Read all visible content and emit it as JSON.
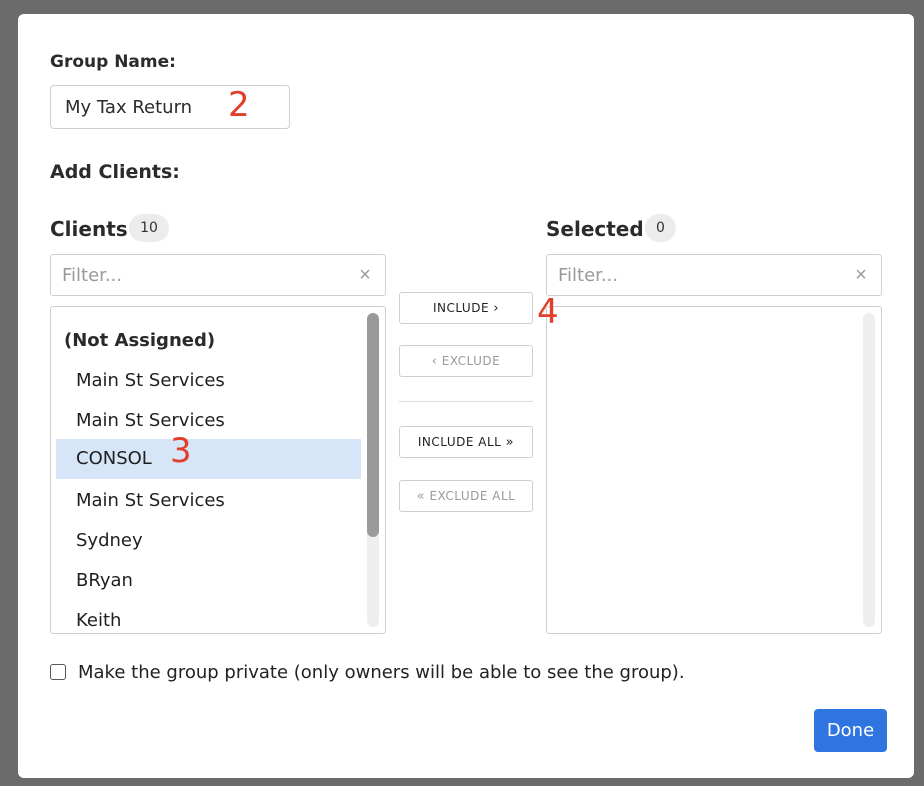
{
  "form": {
    "group_name_label": "Group Name:",
    "group_name_value": "My Tax Return",
    "add_clients_label": "Add Clients:"
  },
  "clients_panel": {
    "title": "Clients",
    "count": "10",
    "filter_placeholder": "Filter...",
    "clear_icon": "×",
    "items": [
      {
        "label": "(Not Assigned)",
        "type": "group-header"
      },
      {
        "label": "Main St Services"
      },
      {
        "label": "Main St Services"
      },
      {
        "label": "CONSOL",
        "selected": true
      },
      {
        "label": "Main St Services"
      },
      {
        "label": "Sydney"
      },
      {
        "label": "BRyan"
      },
      {
        "label": "Keith"
      }
    ]
  },
  "selected_panel": {
    "title": "Selected",
    "count": "0",
    "filter_placeholder": "Filter...",
    "clear_icon": "×",
    "items": []
  },
  "actions": {
    "include_label": "INCLUDE",
    "include_icon": "›",
    "exclude_label": "EXCLUDE",
    "exclude_icon": "‹",
    "include_all_label": "INCLUDE ALL",
    "include_all_icon": "»",
    "exclude_all_label": "EXCLUDE ALL",
    "exclude_all_icon": "«"
  },
  "annotations": [
    "2",
    "3",
    "4"
  ],
  "private_option": {
    "label": "Make the group private (only owners will be able to see the group).",
    "checked": false
  },
  "footer": {
    "done_label": "Done"
  },
  "colors": {
    "accent": "#2f75e0",
    "selected_row": "#d7e5f9",
    "annotation": "#e0402a",
    "backdrop": "#6b6b6b"
  }
}
